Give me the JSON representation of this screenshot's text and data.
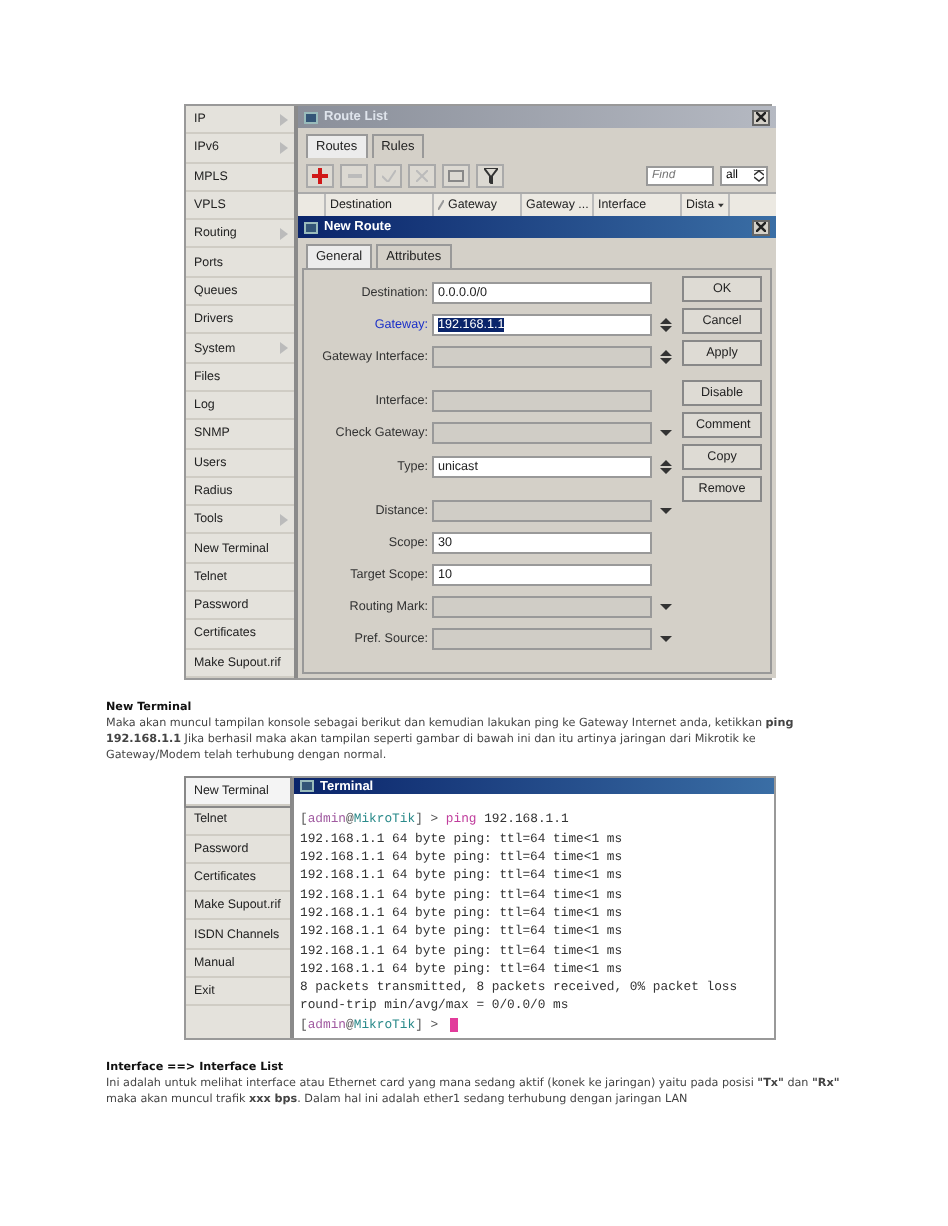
{
  "figure_1": {
    "menu": [
      {
        "label": "IP",
        "has_submenu": true
      },
      {
        "label": "IPv6",
        "has_submenu": true
      },
      {
        "label": "MPLS",
        "has_submenu": false
      },
      {
        "label": "VPLS",
        "has_submenu": false
      },
      {
        "label": "Routing",
        "has_submenu": true
      },
      {
        "label": "Ports",
        "has_submenu": false
      },
      {
        "label": "Queues",
        "has_submenu": false
      },
      {
        "label": "Drivers",
        "has_submenu": false
      },
      {
        "label": "System",
        "has_submenu": true
      },
      {
        "label": "Files",
        "has_submenu": false
      },
      {
        "label": "Log",
        "has_submenu": false
      },
      {
        "label": "SNMP",
        "has_submenu": false
      },
      {
        "label": "Users",
        "has_submenu": false
      },
      {
        "label": "Radius",
        "has_submenu": false
      },
      {
        "label": "Tools",
        "has_submenu": true
      },
      {
        "label": "New Terminal",
        "has_submenu": false
      },
      {
        "label": "Telnet",
        "has_submenu": false
      },
      {
        "label": "Password",
        "has_submenu": false
      },
      {
        "label": "Certificates",
        "has_submenu": false
      },
      {
        "label": "Make Supout.rif",
        "has_submenu": false
      }
    ],
    "route_list": {
      "title": "Route List",
      "tabs": [
        {
          "label": "Routes",
          "selected": true
        },
        {
          "label": "Rules",
          "selected": false
        }
      ],
      "find_placeholder": "Find",
      "filter": "all",
      "columns": [
        "Destination",
        "Gateway",
        "Gateway ...",
        "Interface",
        "Dista"
      ],
      "new_route": {
        "title": "New Route",
        "tabs": [
          {
            "label": "General",
            "selected": true
          },
          {
            "label": "Attributes",
            "selected": false
          }
        ],
        "field_groups": [
          [
            {
              "label": "Destination:",
              "value": "0.0.0.0/0",
              "enabled": true,
              "kind": "none",
              "highlighted": false
            },
            {
              "label": "Gateway:",
              "value": "192.168.1.1",
              "enabled": true,
              "kind": "spin",
              "highlighted": true
            },
            {
              "label": "Gateway Interface:",
              "enabled": false,
              "kind": "spin",
              "highlighted": false
            }
          ],
          [
            {
              "label": "Interface:",
              "enabled": false,
              "kind": "none",
              "highlighted": false
            },
            {
              "label": "Check Gateway:",
              "enabled": false,
              "kind": "dropdown",
              "highlighted": false
            },
            {
              "label": "Type:",
              "value": "unicast",
              "enabled": true,
              "kind": "spin",
              "highlighted": false
            }
          ],
          [
            {
              "label": "Distance:",
              "enabled": false,
              "kind": "dropdown",
              "highlighted": false
            },
            {
              "label": "Scope:",
              "value": "30",
              "enabled": true,
              "kind": "none",
              "highlighted": false
            },
            {
              "label": "Target Scope:",
              "value": "10",
              "enabled": true,
              "kind": "none",
              "highlighted": false
            },
            {
              "label": "Routing Mark:",
              "enabled": false,
              "kind": "dropdown",
              "highlighted": false
            },
            {
              "label": "Pref. Source:",
              "enabled": false,
              "kind": "dropdown",
              "highlighted": false
            }
          ]
        ],
        "button_groups": [
          [
            "OK",
            "Cancel",
            "Apply"
          ],
          [
            "Disable",
            "Comment",
            "Copy",
            "Remove"
          ]
        ]
      }
    }
  },
  "paragraph_1": {
    "heading": "New Terminal",
    "text": "Maka akan muncul tampilan konsole sebagai berikut dan kemudian lakukan ping ke Gateway Internet anda, ketikkan **ping 192.168.1.1** Jika berhasil maka akan tampilan seperti gambar di bawah ini dan itu artinya jaringan dari Mikrotik ke Gateway/Modem telah terhubung dengan normal."
  },
  "figure_2": {
    "menu": [
      {
        "label": "New Terminal",
        "selected": true
      },
      {
        "label": "Telnet",
        "selected": false
      },
      {
        "label": "Password",
        "selected": false
      },
      {
        "label": "Certificates",
        "selected": false
      },
      {
        "label": "Make Supout.rif",
        "selected": false
      },
      {
        "label": "ISDN Channels",
        "selected": false
      },
      {
        "label": "Manual",
        "selected": false
      },
      {
        "label": "Exit",
        "selected": false
      }
    ],
    "terminal": {
      "title": "Terminal",
      "lines": [
        {
          "kind": "prompt",
          "user": "admin",
          "at": "@",
          "host": "MikroTik",
          "open": "[",
          "close": "] >",
          "command": "ping 192.168.1.1",
          "cursor": false
        },
        {
          "kind": "output",
          "text": "192.168.1.1 64 byte ping: ttl=64 time<1 ms"
        },
        {
          "kind": "output",
          "text": "192.168.1.1 64 byte ping: ttl=64 time<1 ms"
        },
        {
          "kind": "output",
          "text": "192.168.1.1 64 byte ping: ttl=64 time<1 ms"
        },
        {
          "kind": "output",
          "text": "192.168.1.1 64 byte ping: ttl=64 time<1 ms"
        },
        {
          "kind": "output",
          "text": "192.168.1.1 64 byte ping: ttl=64 time<1 ms"
        },
        {
          "kind": "output",
          "text": "192.168.1.1 64 byte ping: ttl=64 time<1 ms"
        },
        {
          "kind": "output",
          "text": "192.168.1.1 64 byte ping: ttl=64 time<1 ms"
        },
        {
          "kind": "output",
          "text": "192.168.1.1 64 byte ping: ttl=64 time<1 ms"
        },
        {
          "kind": "output",
          "text": "8 packets transmitted, 8 packets received, 0% packet loss"
        },
        {
          "kind": "output",
          "text": "round-trip min/avg/max = 0/0.0/0 ms"
        },
        {
          "kind": "prompt",
          "user": "admin",
          "at": "@",
          "host": "MikroTik",
          "open": "[",
          "close": "] >",
          "cursor": true
        }
      ]
    }
  },
  "paragraph_2": {
    "heading": "Interface ==> Interface List",
    "text": "Ini adalah untuk melihat interface atau Ethernet card yang mana sedang aktif (konek ke jaringan) yaitu pada posisi **\"Tx\"** dan **\"Rx\"** maka akan muncul trafik **xxx bps**. Dalam hal ini adalah ether1 sedang terhubung dengan jaringan LAN"
  }
}
